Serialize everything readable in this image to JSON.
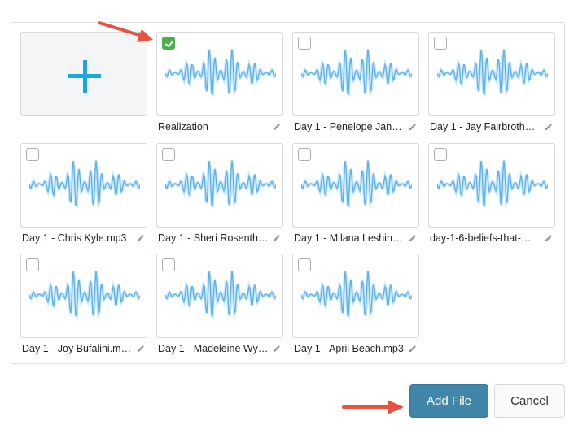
{
  "tiles": [
    {
      "name": "Realization",
      "checked": true
    },
    {
      "name": "Day 1 - Penelope Jan…",
      "checked": false
    },
    {
      "name": "Day 1 - Jay Fairbroth…",
      "checked": false
    },
    {
      "name": "Day 1 - Chris Kyle.mp3",
      "checked": false
    },
    {
      "name": "Day 1 - Sheri Rosenth…",
      "checked": false
    },
    {
      "name": "Day 1 - Milana Leshin…",
      "checked": false
    },
    {
      "name": "day-1-6-beliefs-that-…",
      "checked": false
    },
    {
      "name": "Day 1 - Joy Bufalini.m…",
      "checked": false
    },
    {
      "name": "Day 1 - Madeleine Wy…",
      "checked": false
    },
    {
      "name": "Day 1 - April Beach.mp3",
      "checked": false
    }
  ],
  "actions": {
    "add_file_label": "Add File",
    "cancel_label": "Cancel"
  },
  "icons": {
    "add": "plus-icon",
    "waveform": "audio-waveform-icon",
    "edit": "pencil-icon",
    "check": "checkmark-icon",
    "annotation": "red-arrow-icon"
  },
  "colors": {
    "accent": "#1aa7dc",
    "primary_button": "#3f86a8",
    "checked": "#4cae4c",
    "annotation_arrow": "#e8523f"
  }
}
